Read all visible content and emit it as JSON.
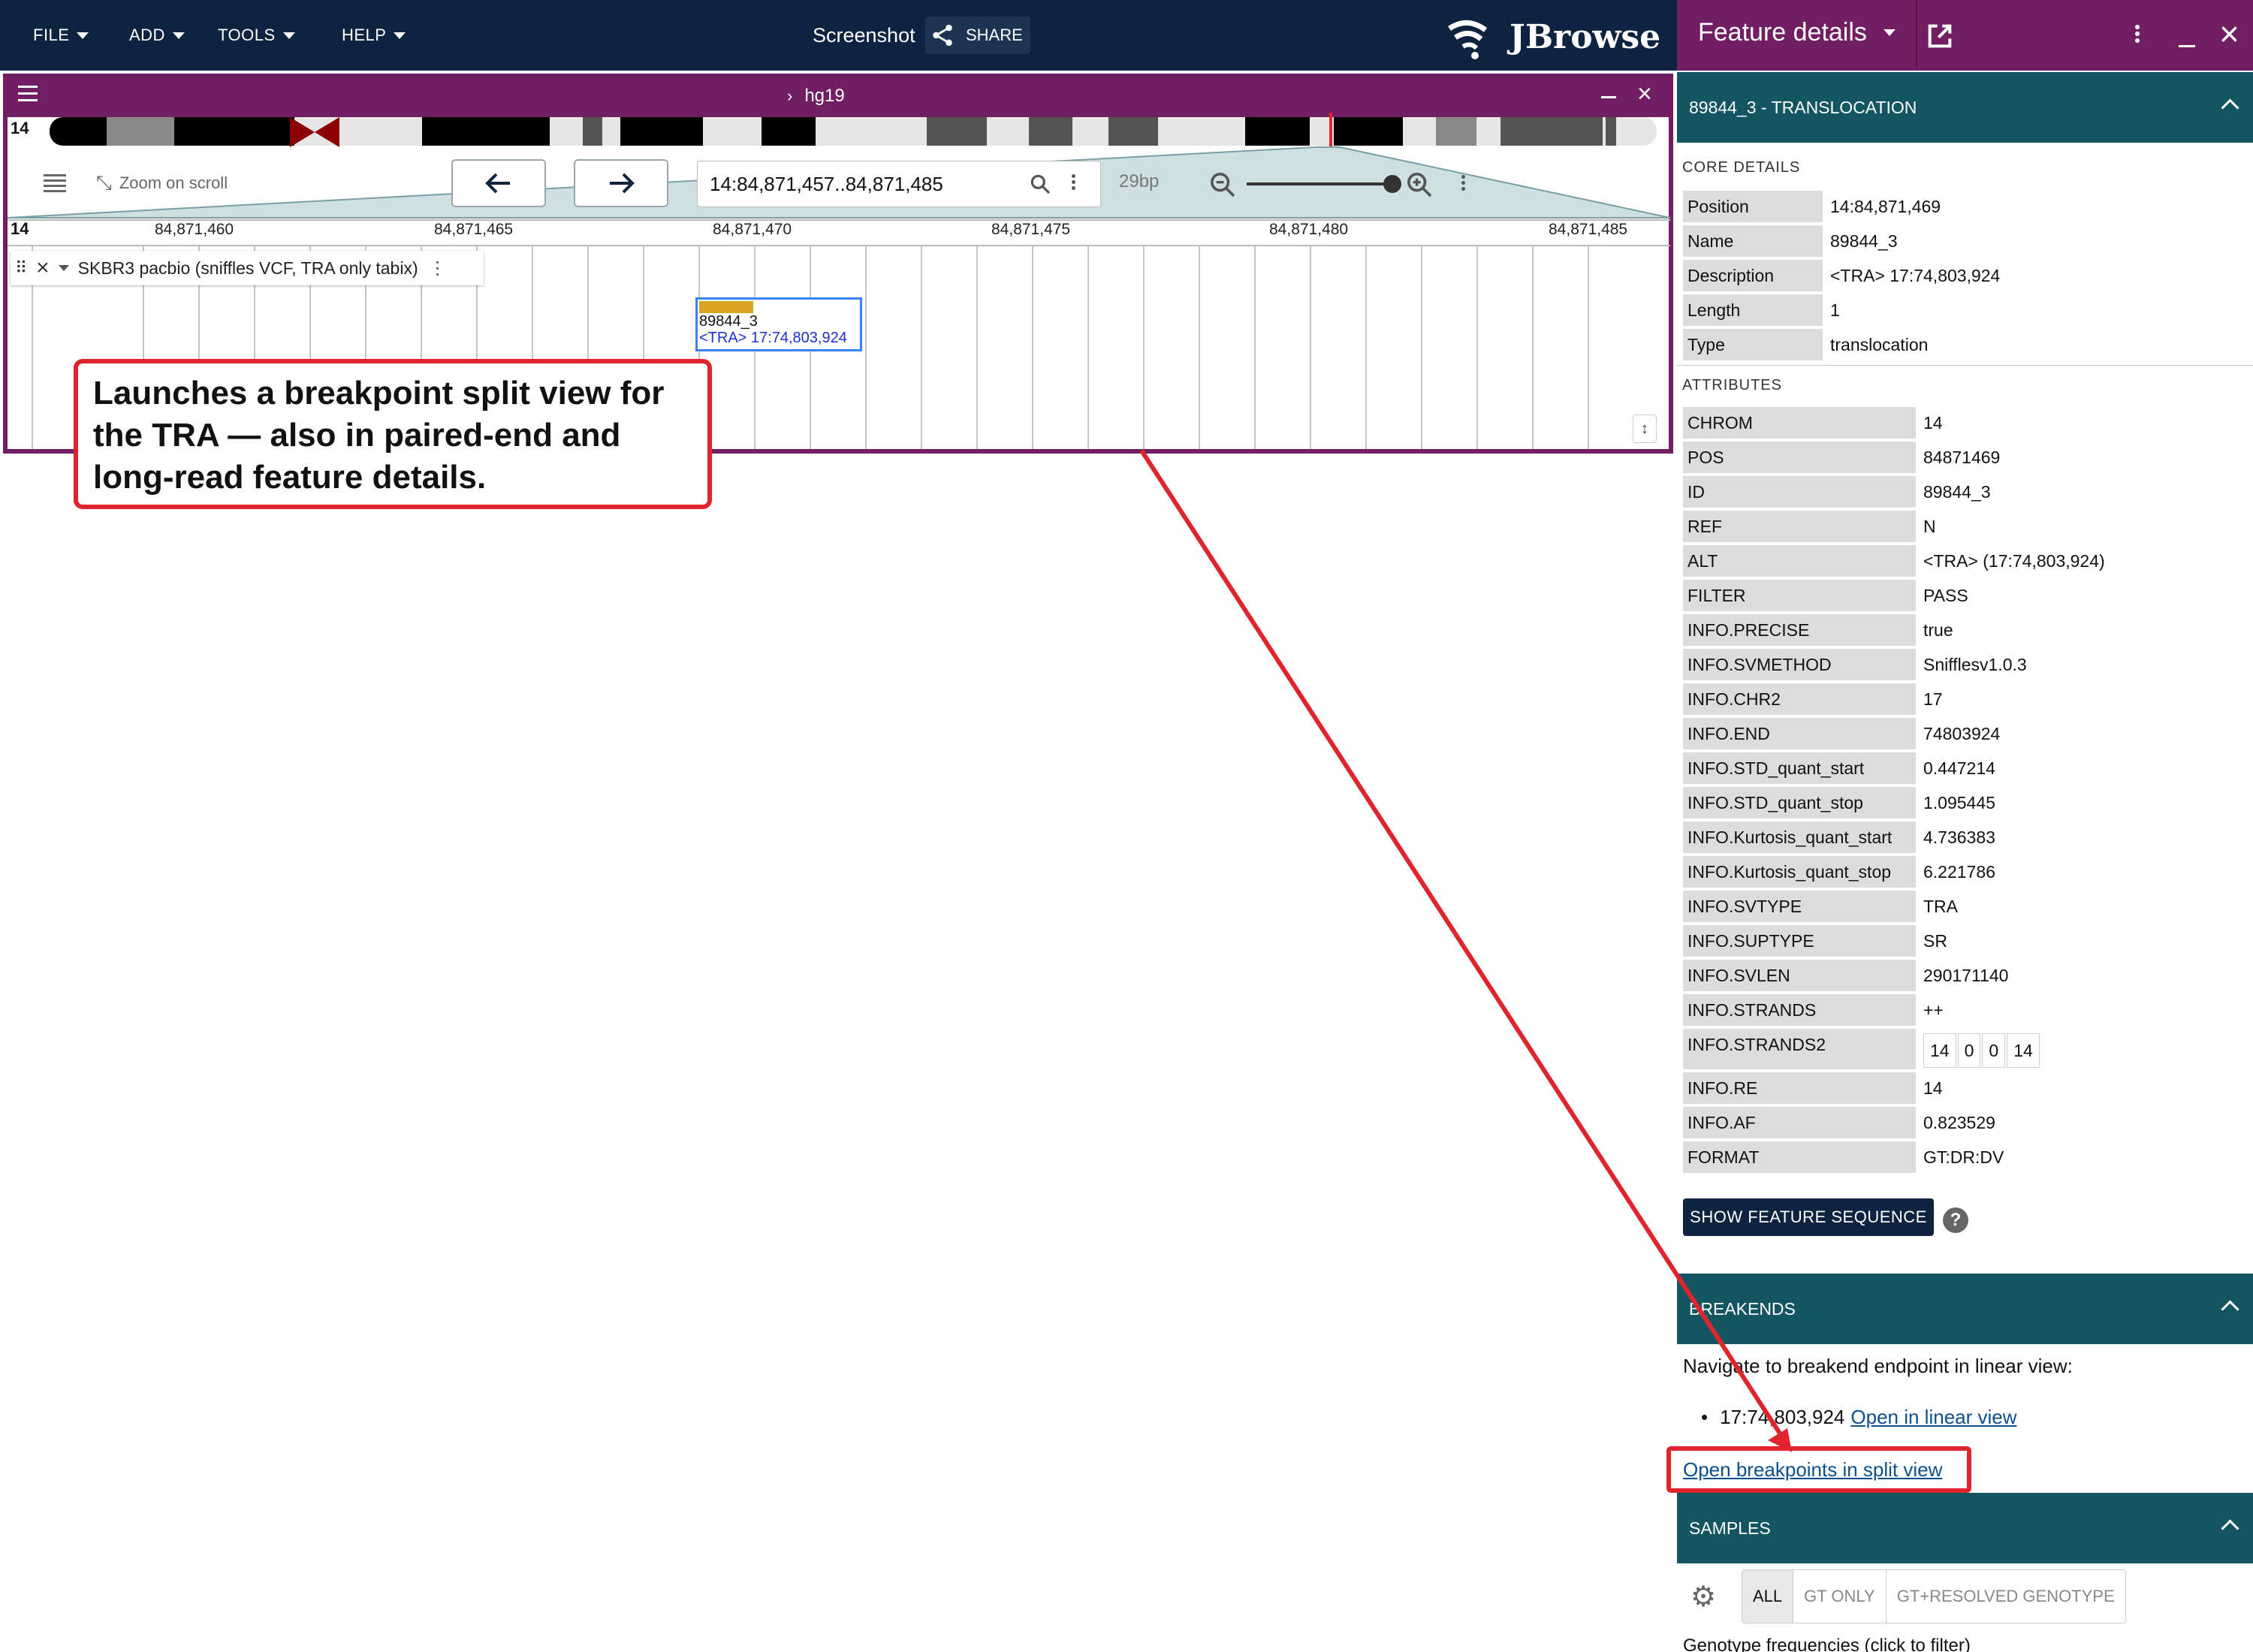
{
  "app_bar": {
    "menus": [
      "FILE",
      "ADD",
      "TOOLS",
      "HELP"
    ],
    "session_name": "Screenshot",
    "share_label": "SHARE",
    "logo_text": "JBrowse"
  },
  "view": {
    "assembly": "hg19",
    "chromosome": "14",
    "zoom_on_scroll": "Zoom on scroll",
    "locstring": "14:84,871,457..84,871,485",
    "bp_per_view": "29bp",
    "ruler_chrom": "14",
    "ruler_ticks": [
      "84,871,460",
      "84,871,465",
      "84,871,470",
      "84,871,475",
      "84,871,480",
      "84,871,485"
    ],
    "track_name": "SKBR3 pacbio (sniffles VCF, TRA only tabix)",
    "feature": {
      "name": "89844_3",
      "description": "<TRA> 17:74,803,924",
      "color": "#daa520"
    }
  },
  "callout": {
    "text": "Launches a breakpoint split view for the TRA — also in paired-end and long-read feature details."
  },
  "drawer": {
    "title": "Feature details",
    "feature_header": "89844_3 - TRANSLOCATION",
    "core_label": "CORE DETAILS",
    "core": [
      {
        "k": "Position",
        "v": "14:84,871,469"
      },
      {
        "k": "Name",
        "v": "89844_3"
      },
      {
        "k": "Description",
        "v": "<TRA> 17:74,803,924"
      },
      {
        "k": "Length",
        "v": "1"
      },
      {
        "k": "Type",
        "v": "translocation"
      }
    ],
    "attributes_label": "ATTRIBUTES",
    "attributes": [
      {
        "k": "CHROM",
        "v": "14"
      },
      {
        "k": "POS",
        "v": "84871469"
      },
      {
        "k": "ID",
        "v": "89844_3"
      },
      {
        "k": "REF",
        "v": "N"
      },
      {
        "k": "ALT",
        "v": "<TRA> (17:74,803,924)"
      },
      {
        "k": "FILTER",
        "v": "PASS"
      },
      {
        "k": "INFO.PRECISE",
        "v": "true"
      },
      {
        "k": "INFO.SVMETHOD",
        "v": "Snifflesv1.0.3"
      },
      {
        "k": "INFO.CHR2",
        "v": "17"
      },
      {
        "k": "INFO.END",
        "v": "74803924"
      },
      {
        "k": "INFO.STD_quant_start",
        "v": "0.447214"
      },
      {
        "k": "INFO.STD_quant_stop",
        "v": "1.095445"
      },
      {
        "k": "INFO.Kurtosis_quant_start",
        "v": "4.736383"
      },
      {
        "k": "INFO.Kurtosis_quant_stop",
        "v": "6.221786"
      },
      {
        "k": "INFO.SVTYPE",
        "v": "TRA"
      },
      {
        "k": "INFO.SUPTYPE",
        "v": "SR"
      },
      {
        "k": "INFO.SVLEN",
        "v": "290171140"
      },
      {
        "k": "INFO.STRANDS",
        "v": "++"
      },
      {
        "k": "INFO.STRANDS2",
        "cells": [
          "14",
          "0",
          "0",
          "14"
        ]
      },
      {
        "k": "INFO.RE",
        "v": "14"
      },
      {
        "k": "INFO.AF",
        "v": "0.823529"
      },
      {
        "k": "FORMAT",
        "v": "GT:DR:DV"
      }
    ],
    "show_sequence_label": "SHOW FEATURE SEQUENCE",
    "breakends_label": "BREAKENDS",
    "navigate_text": "Navigate to breakend endpoint in linear view:",
    "breakend_loc": "17:74,803,924",
    "open_linear_label": "Open in linear view",
    "open_split_label": "Open breakpoints in split view",
    "samples_label": "SAMPLES",
    "filter_tabs": [
      "ALL",
      "GT ONLY",
      "GT+RESOLVED GENOTYPE"
    ],
    "genotype_freq_text": "Genotype frequencies (click to filter)"
  },
  "colors": {
    "app_bar": "#0d233f",
    "view_accent": "#721e63",
    "section_header": "#135560",
    "annotation_red": "#e0242e"
  }
}
